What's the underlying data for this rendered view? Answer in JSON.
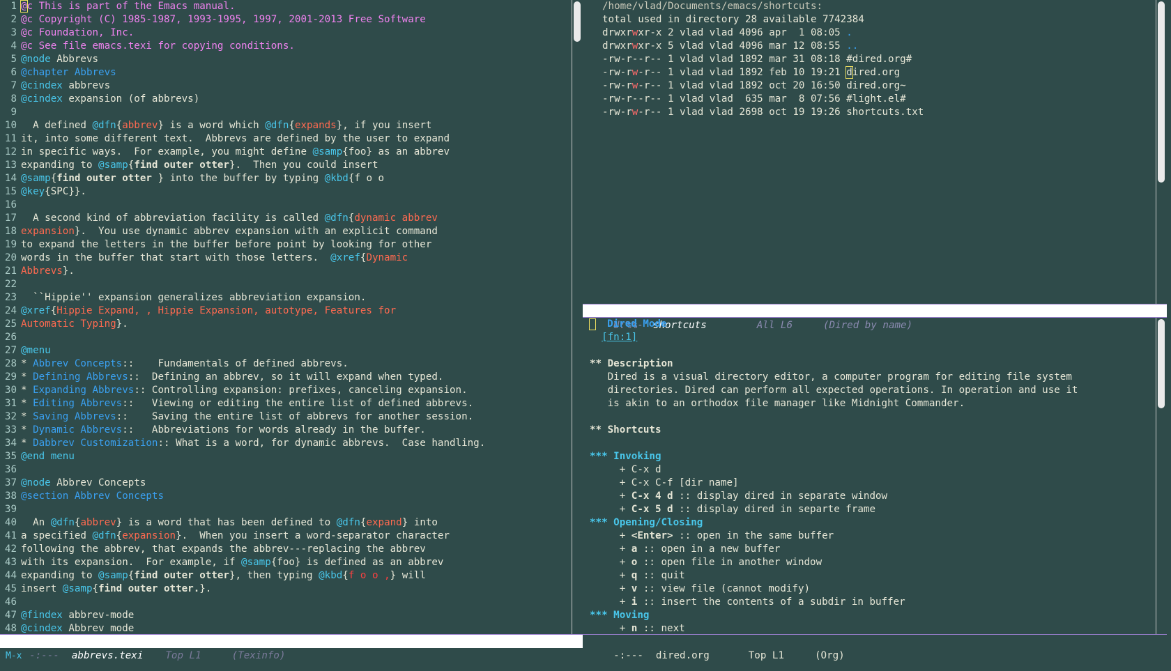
{
  "left_buffer": {
    "lines": [
      {
        "n": "1",
        "segs": [
          [
            "cursor",
            "@"
          ],
          [
            "comment",
            "c This is part of the Emacs manual."
          ]
        ]
      },
      {
        "n": "2",
        "segs": [
          [
            "comment",
            "@c Copyright (C) 1985-1987, 1993-1995, 1997, 2001-2013 Free Software"
          ]
        ]
      },
      {
        "n": "3",
        "segs": [
          [
            "comment",
            "@c Foundation, Inc."
          ]
        ]
      },
      {
        "n": "4",
        "segs": [
          [
            "comment",
            "@c See file emacs.texi for copying conditions."
          ]
        ]
      },
      {
        "n": "5",
        "segs": [
          [
            "cmd",
            "@node"
          ],
          [
            "plain",
            " Abbrevs"
          ]
        ]
      },
      {
        "n": "6",
        "segs": [
          [
            "chap",
            "@chapter Abbrevs"
          ]
        ]
      },
      {
        "n": "7",
        "segs": [
          [
            "cmd",
            "@cindex"
          ],
          [
            "plain",
            " abbrevs"
          ]
        ]
      },
      {
        "n": "8",
        "segs": [
          [
            "cmd",
            "@cindex"
          ],
          [
            "plain",
            " expansion (of abbrevs)"
          ]
        ]
      },
      {
        "n": "9",
        "segs": []
      },
      {
        "n": "10",
        "segs": [
          [
            "plain",
            "  A defined "
          ],
          [
            "cmd",
            "@dfn"
          ],
          [
            "plain",
            "{"
          ],
          [
            "dfn",
            "abbrev"
          ],
          [
            "plain",
            "} is a word which "
          ],
          [
            "cmd",
            "@dfn"
          ],
          [
            "plain",
            "{"
          ],
          [
            "dfn",
            "expands"
          ],
          [
            "plain",
            "}, if you insert"
          ]
        ]
      },
      {
        "n": "11",
        "segs": [
          [
            "plain",
            "it, into some different text.  Abbrevs are defined by the user to expand"
          ]
        ]
      },
      {
        "n": "12",
        "segs": [
          [
            "plain",
            "in specific ways.  For example, you might define "
          ],
          [
            "cmd",
            "@samp"
          ],
          [
            "plain",
            "{foo} as an abbrev"
          ]
        ]
      },
      {
        "n": "13",
        "segs": [
          [
            "plain",
            "expanding to "
          ],
          [
            "cmd",
            "@samp"
          ],
          [
            "plain",
            "{"
          ],
          [
            "bold",
            "find outer otter"
          ],
          [
            "plain",
            "}.  Then you could insert"
          ]
        ]
      },
      {
        "n": "14",
        "segs": [
          [
            "cmd",
            "@samp"
          ],
          [
            "plain",
            "{"
          ],
          [
            "bold",
            "find outer otter "
          ],
          [
            "plain",
            "} into the buffer by typing "
          ],
          [
            "cmd",
            "@kbd"
          ],
          [
            "plain",
            "{f o o"
          ]
        ]
      },
      {
        "n": "15",
        "segs": [
          [
            "cmd",
            "@key"
          ],
          [
            "plain",
            "{SPC}}."
          ]
        ]
      },
      {
        "n": "16",
        "segs": []
      },
      {
        "n": "17",
        "segs": [
          [
            "plain",
            "  A second kind of abbreviation facility is called "
          ],
          [
            "cmd",
            "@dfn"
          ],
          [
            "plain",
            "{"
          ],
          [
            "dfn",
            "dynamic abbrev"
          ]
        ]
      },
      {
        "n": "18",
        "segs": [
          [
            "dfn",
            "expansion"
          ],
          [
            "plain",
            "}.  You use dynamic abbrev expansion with an explicit command"
          ]
        ]
      },
      {
        "n": "19",
        "segs": [
          [
            "plain",
            "to expand the letters in the buffer before point by looking for other"
          ]
        ]
      },
      {
        "n": "20",
        "segs": [
          [
            "plain",
            "words in the buffer that start with those letters.  "
          ],
          [
            "cmd",
            "@xref"
          ],
          [
            "plain",
            "{"
          ],
          [
            "dfn",
            "Dynamic"
          ]
        ]
      },
      {
        "n": "21",
        "segs": [
          [
            "dfn",
            "Abbrevs"
          ],
          [
            "plain",
            "}."
          ]
        ]
      },
      {
        "n": "22",
        "segs": []
      },
      {
        "n": "23",
        "segs": [
          [
            "plain",
            "  ``Hippie'' expansion generalizes abbreviation expansion."
          ]
        ]
      },
      {
        "n": "24",
        "segs": [
          [
            "cmd",
            "@xref"
          ],
          [
            "plain",
            "{"
          ],
          [
            "dfn",
            "Hippie Expand, , Hippie Expansion, autotype, Features for"
          ]
        ]
      },
      {
        "n": "25",
        "segs": [
          [
            "dfn",
            "Automatic Typing"
          ],
          [
            "plain",
            "}."
          ]
        ]
      },
      {
        "n": "26",
        "segs": []
      },
      {
        "n": "27",
        "segs": [
          [
            "cmd",
            "@menu"
          ]
        ]
      },
      {
        "n": "28",
        "segs": [
          [
            "plain",
            "* "
          ],
          [
            "link",
            "Abbrev Concepts"
          ],
          [
            "plain",
            "::    Fundamentals of defined abbrevs."
          ]
        ]
      },
      {
        "n": "29",
        "segs": [
          [
            "plain",
            "* "
          ],
          [
            "link",
            "Defining Abbrevs"
          ],
          [
            "plain",
            "::  Defining an abbrev, so it will expand when typed."
          ]
        ]
      },
      {
        "n": "30",
        "segs": [
          [
            "plain",
            "* "
          ],
          [
            "link",
            "Expanding Abbrevs"
          ],
          [
            "plain",
            ":: Controlling expansion: prefixes, canceling expansion."
          ]
        ]
      },
      {
        "n": "31",
        "segs": [
          [
            "plain",
            "* "
          ],
          [
            "link",
            "Editing Abbrevs"
          ],
          [
            "plain",
            "::   Viewing or editing the entire list of defined abbrevs."
          ]
        ]
      },
      {
        "n": "32",
        "segs": [
          [
            "plain",
            "* "
          ],
          [
            "link",
            "Saving Abbrevs"
          ],
          [
            "plain",
            "::    Saving the entire list of abbrevs for another session."
          ]
        ]
      },
      {
        "n": "33",
        "segs": [
          [
            "plain",
            "* "
          ],
          [
            "link",
            "Dynamic Abbrevs"
          ],
          [
            "plain",
            "::   Abbreviations for words already in the buffer."
          ]
        ]
      },
      {
        "n": "34",
        "segs": [
          [
            "plain",
            "* "
          ],
          [
            "link",
            "Dabbrev Customization"
          ],
          [
            "plain",
            ":: What is a word, for dynamic abbrevs.  Case handling."
          ]
        ]
      },
      {
        "n": "35",
        "segs": [
          [
            "cmd",
            "@end menu"
          ]
        ]
      },
      {
        "n": "36",
        "segs": []
      },
      {
        "n": "37",
        "segs": [
          [
            "cmd",
            "@node"
          ],
          [
            "plain",
            " Abbrev Concepts"
          ]
        ]
      },
      {
        "n": "38",
        "segs": [
          [
            "chap",
            "@section Abbrev Concepts"
          ]
        ]
      },
      {
        "n": "39",
        "segs": []
      },
      {
        "n": "40",
        "segs": [
          [
            "plain",
            "  An "
          ],
          [
            "cmd",
            "@dfn"
          ],
          [
            "plain",
            "{"
          ],
          [
            "dfn",
            "abbrev"
          ],
          [
            "plain",
            "} is a word that has been defined to "
          ],
          [
            "cmd",
            "@dfn"
          ],
          [
            "plain",
            "{"
          ],
          [
            "dfn",
            "expand"
          ],
          [
            "plain",
            "} into"
          ]
        ]
      },
      {
        "n": "41",
        "segs": [
          [
            "plain",
            "a specified "
          ],
          [
            "cmd",
            "@dfn"
          ],
          [
            "plain",
            "{"
          ],
          [
            "dfn",
            "expansion"
          ],
          [
            "plain",
            "}.  When you insert a word-separator character"
          ]
        ]
      },
      {
        "n": "42",
        "segs": [
          [
            "plain",
            "following the abbrev, that expands the abbrev---replacing the abbrev"
          ]
        ]
      },
      {
        "n": "43",
        "segs": [
          [
            "plain",
            "with its expansion.  For example, if "
          ],
          [
            "cmd",
            "@samp"
          ],
          [
            "plain",
            "{foo} is defined as an abbrev"
          ]
        ]
      },
      {
        "n": "44",
        "segs": [
          [
            "plain",
            "expanding to "
          ],
          [
            "cmd",
            "@samp"
          ],
          [
            "plain",
            "{"
          ],
          [
            "bold",
            "find outer otter"
          ],
          [
            "plain",
            "}, then typing "
          ],
          [
            "cmd",
            "@kbd"
          ],
          [
            "plain",
            "{"
          ],
          [
            "kbd",
            "f o o ,"
          ],
          [
            "plain",
            "} will"
          ]
        ]
      },
      {
        "n": "45",
        "segs": [
          [
            "plain",
            "insert "
          ],
          [
            "cmd",
            "@samp"
          ],
          [
            "plain",
            "{"
          ],
          [
            "bold",
            "find outer otter."
          ],
          [
            "plain",
            "}."
          ]
        ]
      },
      {
        "n": "46",
        "segs": []
      },
      {
        "n": "47",
        "segs": [
          [
            "cmd",
            "@findex"
          ],
          [
            "plain",
            " abbrev-mode"
          ]
        ]
      },
      {
        "n": "48",
        "segs": [
          [
            "cmd",
            "@cindex"
          ],
          [
            "plain",
            " Abbrev mode"
          ]
        ]
      }
    ]
  },
  "dired": {
    "header": "/home/vlad/Documents/emacs/shortcuts:",
    "total": "total used in directory 28 available 7742384",
    "entries": [
      {
        "perm": "drwxrwxr-x",
        "links": "2",
        "user": "vlad",
        "group": "vlad",
        "size": "4096",
        "date": "apr  1 08:05",
        "name": ".",
        "dir": true
      },
      {
        "perm": "drwxrwxr-x",
        "links": "5",
        "user": "vlad",
        "group": "vlad",
        "size": "4096",
        "date": "mar 12 08:55",
        "name": "..",
        "dir": true
      },
      {
        "perm": "-rw-r--r--",
        "links": "1",
        "user": "vlad",
        "group": "vlad",
        "size": "1892",
        "date": "mar 31 08:18",
        "name": "#dired.org#",
        "dir": false
      },
      {
        "perm": "-rw-rw-r--",
        "links": "1",
        "user": "vlad",
        "group": "vlad",
        "size": "1892",
        "date": "feb 10 19:21",
        "name": "dired.org",
        "dir": false,
        "cursor": true
      },
      {
        "perm": "-rw-rw-r--",
        "links": "1",
        "user": "vlad",
        "group": "vlad",
        "size": "1892",
        "date": "oct 20 16:50",
        "name": "dired.org~",
        "dir": false
      },
      {
        "perm": "-rw-r--r--",
        "links": "1",
        "user": "vlad",
        "group": "vlad",
        "size": " 635",
        "date": "mar  8 07:56",
        "name": "#light.el#",
        "dir": false
      },
      {
        "perm": "-rw-rw-r--",
        "links": "1",
        "user": "vlad",
        "group": "vlad",
        "size": "2698",
        "date": "oct 19 19:26",
        "name": "shortcuts.txt",
        "dir": false
      }
    ],
    "modeline": {
      "status": "U:%%-",
      "buffer": "shortcuts",
      "position": "All L6",
      "mode": "(Dired by name)"
    }
  },
  "org": {
    "title": "Dired Mode",
    "footnote": "[fn:1]",
    "lines": [
      {
        "type": "h2",
        "text": "** Description"
      },
      {
        "type": "text",
        "text": "   Dired is a visual directory editor, a computer program for editing file system"
      },
      {
        "type": "text",
        "text": "   directories. Dired can perform all expected operations. In operation and use it"
      },
      {
        "type": "text",
        "text": "   is akin to an orthodox file manager like Midnight Commander."
      },
      {
        "type": "blank",
        "text": ""
      },
      {
        "type": "h2",
        "text": "** Shortcuts"
      },
      {
        "type": "blank",
        "text": ""
      },
      {
        "type": "h3",
        "text": "*** Invoking"
      },
      {
        "type": "item",
        "key": "",
        "text": "     + C-x d"
      },
      {
        "type": "item",
        "key": "",
        "text": "     + C-x C-f [dir name]"
      },
      {
        "type": "itemkey",
        "pre": "     + ",
        "key": "C-x 4 d",
        "post": " :: display dired in separate window"
      },
      {
        "type": "itemkey",
        "pre": "     + ",
        "key": "C-x 5 d",
        "post": " :: display dired in separte frame"
      },
      {
        "type": "h3",
        "text": "*** Opening/Closing"
      },
      {
        "type": "itemkey",
        "pre": "     + ",
        "key": "<Enter>",
        "post": " :: open in the same buffer"
      },
      {
        "type": "itemkey",
        "pre": "     + ",
        "key": "a",
        "post": " :: open in a new buffer"
      },
      {
        "type": "itemkey",
        "pre": "     + ",
        "key": "o",
        "post": " :: open file in another window"
      },
      {
        "type": "itemkey",
        "pre": "     + ",
        "key": "q",
        "post": " :: quit"
      },
      {
        "type": "itemkey",
        "pre": "     + ",
        "key": "v",
        "post": " :: view file (cannot modify)"
      },
      {
        "type": "itemkey",
        "pre": "     + ",
        "key": "i",
        "post": " :: insert the contents of a subdir in buffer"
      },
      {
        "type": "h3",
        "text": "*** Moving"
      },
      {
        "type": "itemkey",
        "pre": "     + ",
        "key": "n",
        "post": " :: next"
      }
    ],
    "modeline": {
      "status": "-:---",
      "buffer": "dired.org",
      "position": "Top L1",
      "mode": "(Org)"
    }
  },
  "left_modeline": {
    "status": "-:---",
    "buffer": "abbrevs.texi",
    "position": "Top L1",
    "mode": "(Texinfo)"
  },
  "minibuffer": "M-x",
  "colors": {
    "background": "#2f4b4a",
    "comment": "#ee82ee",
    "command": "#49c6ea",
    "definition": "#ff6a50",
    "link": "#3aa0f0"
  }
}
